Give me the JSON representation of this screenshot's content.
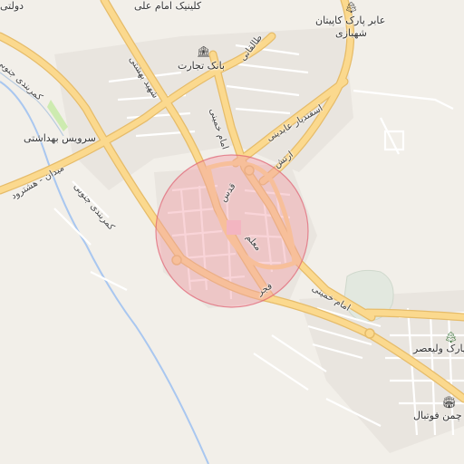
{
  "map": {
    "labels": {
      "top_left": "دولتی",
      "clinic": "کلینیک امام علی",
      "park": "عابر پارک کاپیتان",
      "park_line2": "شهبازی",
      "bank": "بانک تجارت",
      "health_service": "سرویس بهداشتی",
      "park_vali": "پارک ولیعصر",
      "chaman": "چمن فوتبال"
    },
    "roads": {
      "kamarbandi_north": "کمربندی جنوبی",
      "kamarbandi_south": "کمربندی جنوبی",
      "shahid_beheshti": "شهید بهشتی",
      "taleghani": "طالقانی",
      "imam_khomeini_north": "امام خمینی",
      "esfandiar": "اسفندیار عابدینی",
      "artesh": "ارتش",
      "qods": "قدس",
      "meydan": "میدان - هشترود",
      "moallem": "معلم",
      "fajr": "فجر",
      "imam_khomeini_south": "امام خمینی"
    },
    "icons": {
      "bank": "bank-icon",
      "park": "tree-icon",
      "park_vali": "tree-icon",
      "chaman": "stadium-icon"
    },
    "colors": {
      "background": "#f2efe9",
      "major_road": "#fbd98e",
      "road_casing": "#e8bf6a",
      "minor_road": "#ffffff",
      "water": "#a9c7f0",
      "park": "#cdebb0",
      "circle_fill": "#f2a0a8",
      "circle_stroke": "#e06070"
    }
  }
}
